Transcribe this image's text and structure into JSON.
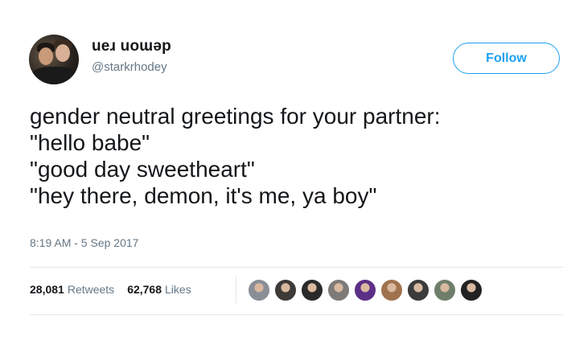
{
  "user": {
    "display_name": "ueɹ uoɯəp",
    "handle": "@starkrhodey"
  },
  "follow_label": "Follow",
  "tweet": {
    "text": "gender neutral greetings for your partner:\n\"hello babe\"\n\"good day sweetheart\"\n\"hey there, demon, it's me, ya boy\"",
    "timestamp": "8:19 AM - 5 Sep 2017"
  },
  "stats": {
    "retweets_count": "28,081",
    "retweets_label": "Retweets",
    "likes_count": "62,768",
    "likes_label": "Likes"
  },
  "likers": [
    {
      "icon": "liker-avatar-1-icon",
      "color": "#8a8f96"
    },
    {
      "icon": "liker-avatar-2-icon",
      "color": "#3e3a37"
    },
    {
      "icon": "liker-avatar-3-icon",
      "color": "#2a2a2a"
    },
    {
      "icon": "liker-avatar-4-icon",
      "color": "#7d7a78"
    },
    {
      "icon": "liker-avatar-5-icon",
      "color": "#5c2f86"
    },
    {
      "icon": "liker-avatar-6-icon",
      "color": "#a0724e"
    },
    {
      "icon": "liker-avatar-7-icon",
      "color": "#3b3b3b"
    },
    {
      "icon": "liker-avatar-8-icon",
      "color": "#6f7e6a"
    },
    {
      "icon": "liker-avatar-9-icon",
      "color": "#222222"
    }
  ],
  "colors": {
    "accent": "#1da1f2",
    "text": "#14171a",
    "secondary_text": "#657786"
  }
}
